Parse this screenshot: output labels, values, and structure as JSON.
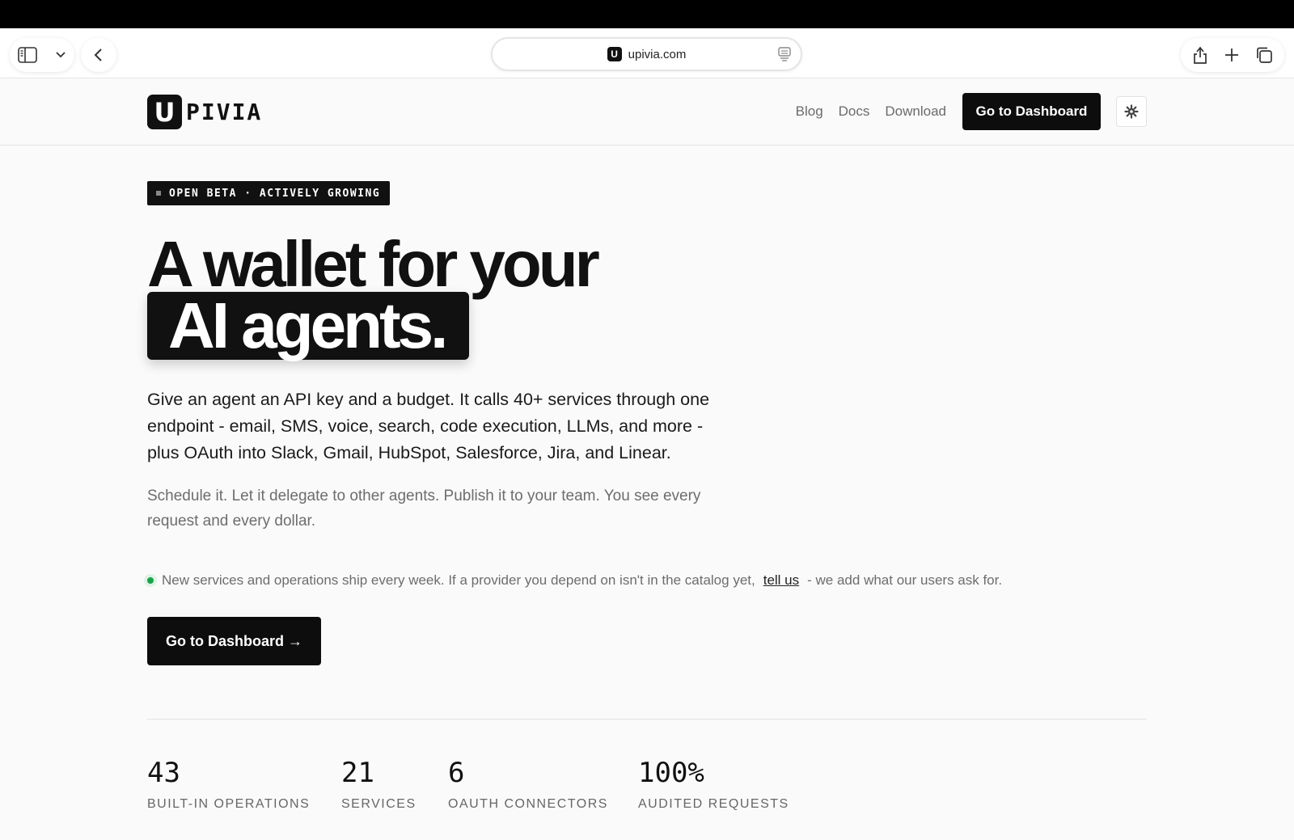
{
  "browser": {
    "url": "upivia.com",
    "favicon_letter": "U"
  },
  "header": {
    "logo_mark": "U",
    "logo_text": "PIVIA",
    "nav": {
      "blog": "Blog",
      "docs": "Docs",
      "download": "Download",
      "cta": "Go to Dashboard"
    }
  },
  "hero": {
    "badge": "OPEN BETA · ACTIVELY GROWING",
    "headline_line1": "A wallet for your",
    "headline_line2": "AI agents.",
    "lead": "Give an agent an API key and a budget. It calls 40+ services through one endpoint - email, SMS, voice, search, code execution, LLMs, and more - plus OAuth into Slack, Gmail, HubSpot, Salesforce, Jira, and Linear.",
    "sub": "Schedule it. Let it delegate to other agents. Publish it to your team. You see every request and every dollar.",
    "notice_before": "New services and operations ship every week. If a provider you depend on isn't in the catalog yet,",
    "notice_link": "tell us",
    "notice_after": "- we add what our users ask for.",
    "cta": "Go to Dashboard →"
  },
  "stats": [
    {
      "value": "43",
      "label": "BUILT-IN OPERATIONS"
    },
    {
      "value": "21",
      "label": "SERVICES"
    },
    {
      "value": "6",
      "label": "OAUTH CONNECTORS"
    },
    {
      "value": "100%",
      "label": "AUDITED REQUESTS"
    }
  ],
  "colors": {
    "accent": "#0d0d0d",
    "status_green": "#17a34a",
    "background": "#fafafa"
  }
}
